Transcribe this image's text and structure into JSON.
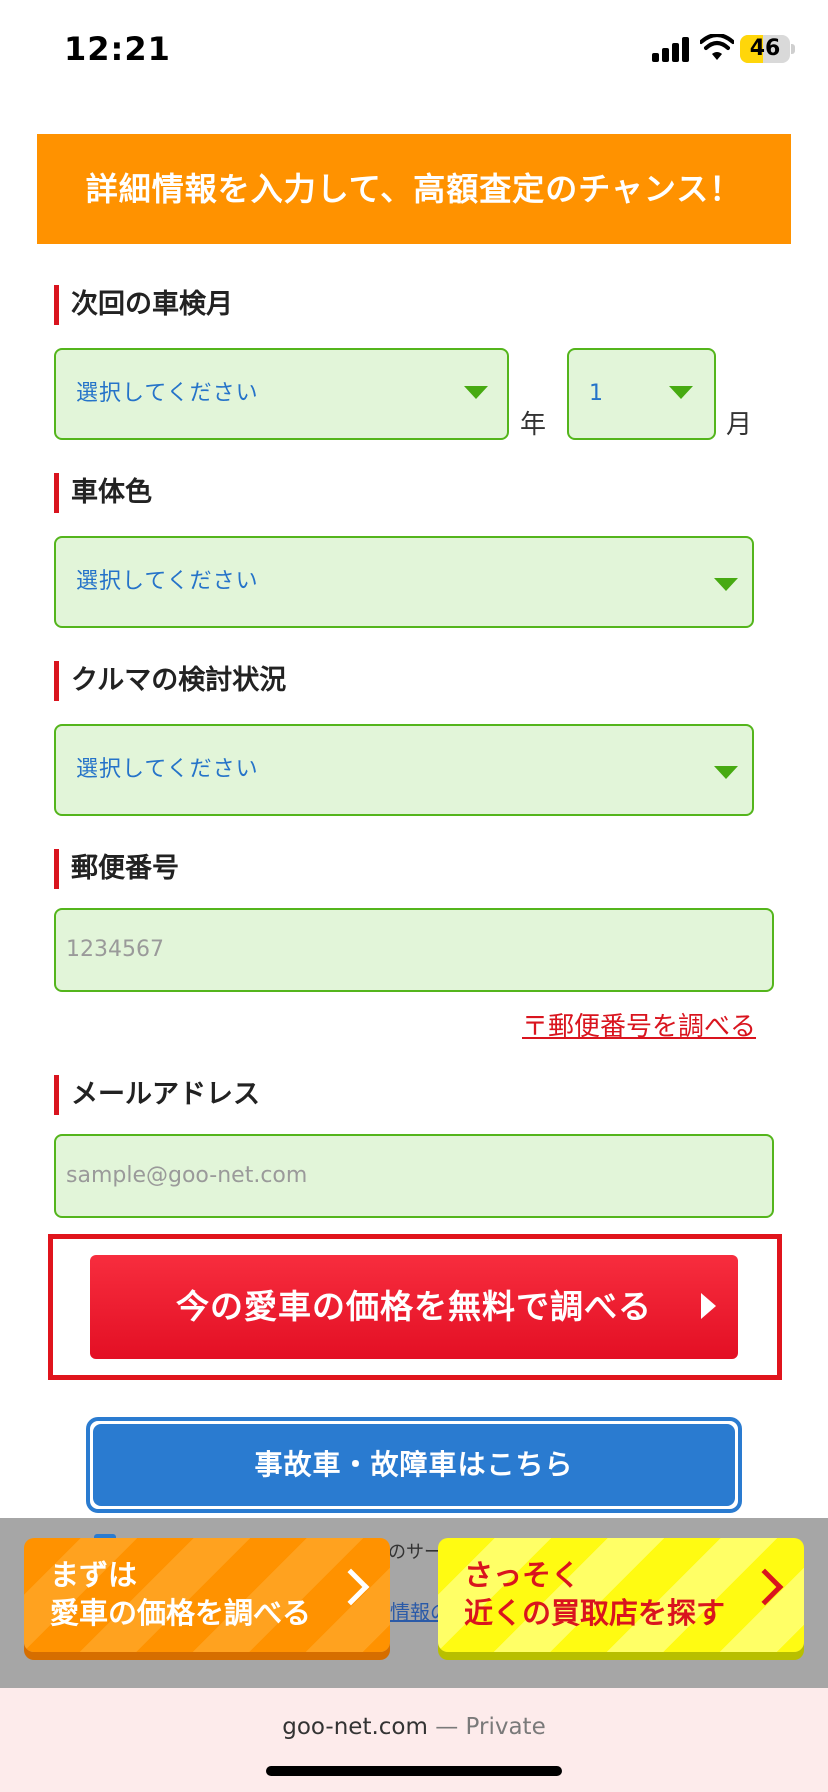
{
  "status_bar": {
    "time": "12:21",
    "battery": "46"
  },
  "banner": {
    "text": "詳細情報を入力して、高額査定のチャンス！"
  },
  "inspection": {
    "label": "次回の車検月",
    "year_select": "選択してください",
    "year_unit": "年",
    "month_select": "1",
    "month_unit": "月"
  },
  "color": {
    "label": "車体色",
    "select": "選択してください"
  },
  "status": {
    "label": "クルマの検討状況",
    "select": "選択してください"
  },
  "zip": {
    "label": "郵便番号",
    "placeholder": "1234567",
    "lookup_link": "〒郵便番号を調べる"
  },
  "email": {
    "label": "メールアドレス",
    "placeholder": "sample@goo-net.com"
  },
  "cta": {
    "label": "今の愛車の価格を無料で調べる"
  },
  "accident": {
    "label": "事故車・故障車はこちら"
  },
  "sticky": {
    "peek_text": "のサー",
    "peek_link": "情報の",
    "check_btn": {
      "line1": "まずは",
      "line2": "愛車の価格を調べる"
    },
    "shop_btn": {
      "line1": "さっそく",
      "line2": "近くの買取店を探す"
    }
  },
  "url_bar": {
    "domain": "goo-net.com",
    "suffix": " — Private"
  },
  "colors": {
    "orange": "#ff9200",
    "green_border": "#54b51c",
    "field_bg": "#e2f5d9",
    "red": "#d9141e",
    "blue": "#2a7bd0",
    "yellow": "#fffb12"
  }
}
